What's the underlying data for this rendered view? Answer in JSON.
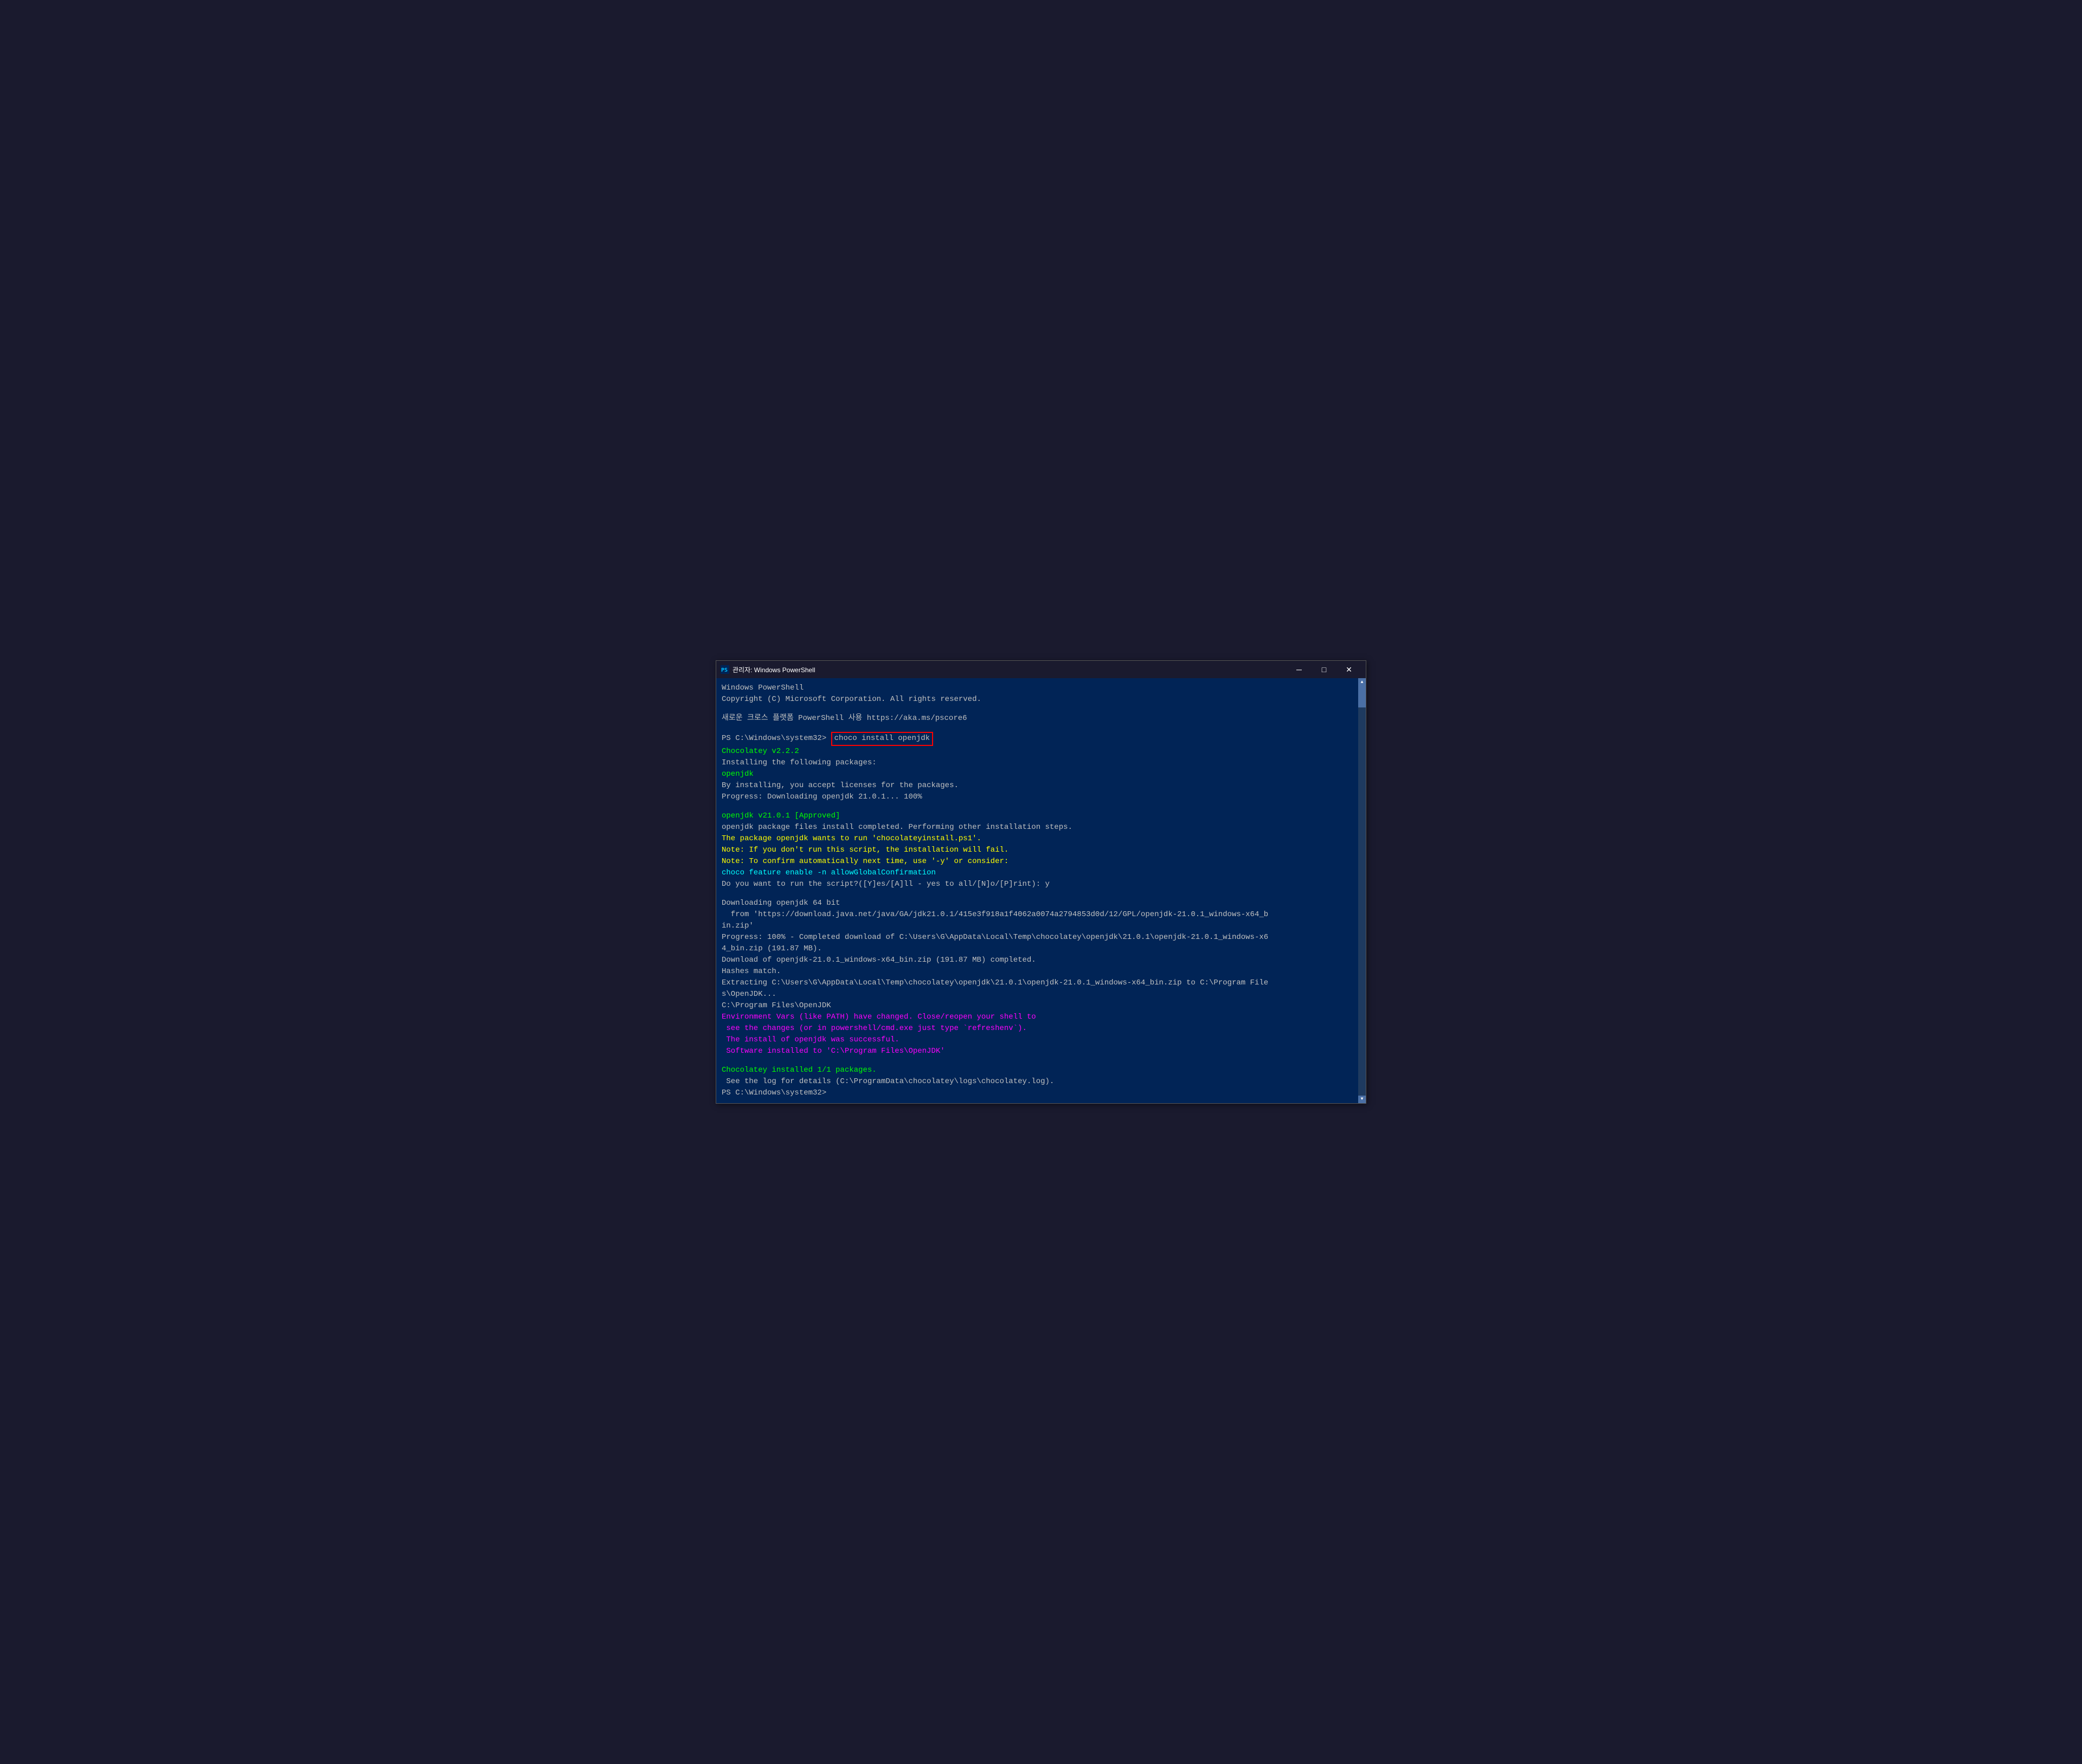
{
  "window": {
    "title": "관리자: Windows PowerShell",
    "icon": "powershell"
  },
  "titlebar": {
    "minimize_label": "─",
    "maximize_label": "□",
    "close_label": "✕"
  },
  "terminal": {
    "lines": [
      {
        "type": "white",
        "text": "Windows PowerShell"
      },
      {
        "type": "white",
        "text": "Copyright (C) Microsoft Corporation. All rights reserved."
      },
      {
        "type": "blank"
      },
      {
        "type": "white",
        "text": "새로운 크로스 플랫폼 PowerShell 사용 https://aka.ms/pscore6"
      },
      {
        "type": "blank"
      },
      {
        "type": "prompt_command"
      },
      {
        "type": "green",
        "text": "Chocolatey v2.2.2"
      },
      {
        "type": "white",
        "text": "Installing the following packages:"
      },
      {
        "type": "green",
        "text": "openjdk"
      },
      {
        "type": "white",
        "text": "By installing, you accept licenses for the packages."
      },
      {
        "type": "white",
        "text": "Progress: Downloading openjdk 21.0.1... 100%"
      },
      {
        "type": "blank"
      },
      {
        "type": "green",
        "text": "openjdk v21.0.1 [Approved]"
      },
      {
        "type": "white",
        "text": "openjdk package files install completed. Performing other installation steps."
      },
      {
        "type": "yellow",
        "text": "The package openjdk wants to run 'chocolateyinstall.ps1'."
      },
      {
        "type": "yellow",
        "text": "Note: If you don't run this script, the installation will fail."
      },
      {
        "type": "yellow",
        "text": "Note: To confirm automatically next time, use '-y' or consider:"
      },
      {
        "type": "cyan",
        "text": "choco feature enable -n allowGlobalConfirmation"
      },
      {
        "type": "white",
        "text": "Do you want to run the script?([Y]es/[A]ll - yes to all/[N]o/[P]rint): y"
      },
      {
        "type": "blank"
      },
      {
        "type": "white",
        "text": "Downloading openjdk 64 bit"
      },
      {
        "type": "white",
        "text": "  from 'https://download.java.net/java/GA/jdk21.0.1/415e3f918a1f4062a0074a2794853d0d/12/GPL/openjdk-21.0.1_windows-x64_b"
      },
      {
        "type": "white",
        "text": "in.zip'"
      },
      {
        "type": "white",
        "text": "Progress: 100% - Completed download of C:\\Users\\G\\AppData\\Local\\Temp\\chocolatey\\openjdk\\21.0.1\\openjdk-21.0.1_windows-x6"
      },
      {
        "type": "white",
        "text": "4_bin.zip (191.87 MB)."
      },
      {
        "type": "white",
        "text": "Download of openjdk-21.0.1_windows-x64_bin.zip (191.87 MB) completed."
      },
      {
        "type": "white",
        "text": "Hashes match."
      },
      {
        "type": "white",
        "text": "Extracting C:\\Users\\G\\AppData\\Local\\Temp\\chocolatey\\openjdk\\21.0.1\\openjdk-21.0.1_windows-x64_bin.zip to C:\\Program File"
      },
      {
        "type": "white",
        "text": "s\\OpenJDK..."
      },
      {
        "type": "white",
        "text": "C:\\Program Files\\OpenJDK"
      },
      {
        "type": "magenta",
        "text": "Environment Vars (like PATH) have changed. Close/reopen your shell to"
      },
      {
        "type": "magenta",
        "text": " see the changes (or in powershell/cmd.exe just type `refreshenv`)."
      },
      {
        "type": "magenta",
        "text": " The install of openjdk was successful."
      },
      {
        "type": "magenta",
        "text": " Software installed to 'C:\\Program Files\\OpenJDK'"
      },
      {
        "type": "blank"
      },
      {
        "type": "green",
        "text": "Chocolatey installed 1/1 packages."
      },
      {
        "type": "white",
        "text": " See the log for details (C:\\ProgramData\\chocolatey\\logs\\chocolatey.log)."
      },
      {
        "type": "prompt_end"
      }
    ],
    "prompt": "PS C:\\Windows\\system32> ",
    "command": "choco install openjdk"
  }
}
